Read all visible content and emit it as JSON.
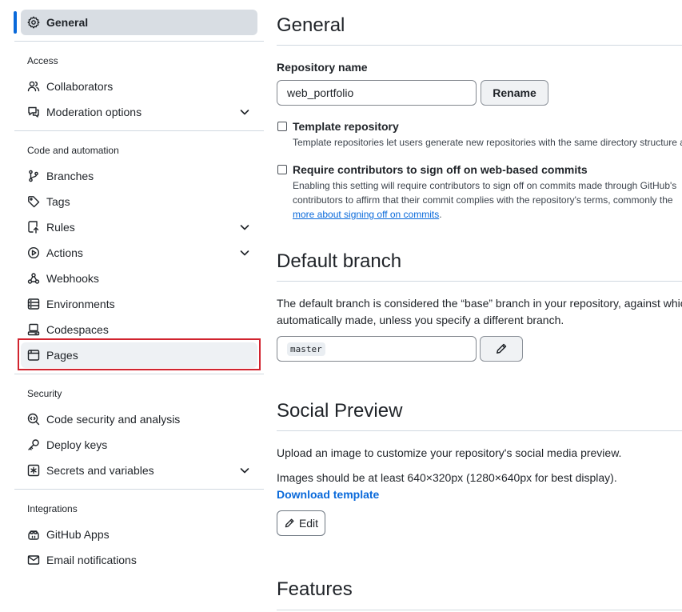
{
  "sidebar": {
    "general": "General",
    "sections": {
      "access": "Access",
      "code_automation": "Code and automation",
      "security": "Security",
      "integrations": "Integrations"
    },
    "items": {
      "collaborators": "Collaborators",
      "moderation": "Moderation options",
      "branches": "Branches",
      "tags": "Tags",
      "rules": "Rules",
      "actions": "Actions",
      "webhooks": "Webhooks",
      "environments": "Environments",
      "codespaces": "Codespaces",
      "pages": "Pages",
      "code_security": "Code security and analysis",
      "deploy_keys": "Deploy keys",
      "secrets": "Secrets and variables",
      "github_apps": "GitHub Apps",
      "email_notifications": "Email notifications"
    }
  },
  "main": {
    "general_title": "General",
    "repo_name_label": "Repository name",
    "repo_name_value": "web_portfolio",
    "rename_button": "Rename",
    "template_label": "Template repository",
    "template_desc": "Template repositories let users generate new repositories with the same directory structure a",
    "signoff_label": "Require contributors to sign off on web-based commits",
    "signoff_desc_1": "Enabling this setting will require contributors to sign off on commits made through GitHub's",
    "signoff_desc_2": "contributors to affirm that their commit complies with the repository's terms, commonly the",
    "signoff_link": "more about signing off on commits",
    "signoff_desc_end": ".",
    "default_branch_title": "Default branch",
    "default_branch_desc_1": "The default branch is considered the “base” branch in your repository, against whic",
    "default_branch_desc_2": "automatically made, unless you specify a different branch.",
    "default_branch_value": "master",
    "social_title": "Social Preview",
    "social_desc_1": "Upload an image to customize your repository's social media preview.",
    "social_desc_2": "Images should be at least 640×320px (1280×640px for best display).",
    "download_template": "Download template",
    "edit_button": "Edit",
    "features_title": "Features"
  }
}
